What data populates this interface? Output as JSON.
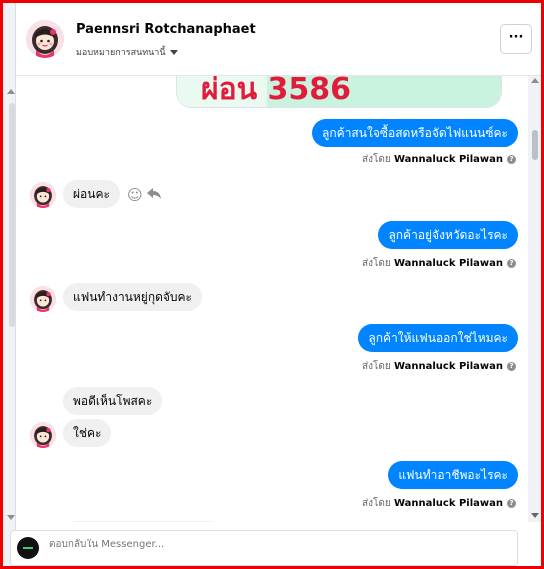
{
  "header": {
    "name": "Paennsri Rotchanaphaet",
    "assign_label": "มอบหมายการสนทนานี้",
    "more_label": "···"
  },
  "banner": {
    "text": "ผ่อน 3586"
  },
  "messages": {
    "m1": {
      "text": "ลูกค้าสนใจซื้อสดหรือจัดไฟแนนซ์คะ"
    },
    "m2": {
      "text": "ผ่อนคะ"
    },
    "m3": {
      "text": "ลูกค้าอยู่จังหวัดอะไรคะ"
    },
    "m4": {
      "text": "แฟนทำงานหยู่กุดจับคะ"
    },
    "m5": {
      "text": "ลูกค้าให้แฟนออกใช่ไหมคะ"
    },
    "m6": {
      "text": "พอดีเห็นโพสคะ"
    },
    "m7": {
      "text": "ใช่คะ"
    },
    "m8": {
      "text": "แฟนทำอาชีพอะไรคะ"
    }
  },
  "sent_by": {
    "prefix": "ส่งโดย",
    "agent": "Wannaluck Pilawan"
  },
  "composer": {
    "placeholder": "ตอบกลับใน Messenger..."
  },
  "colors": {
    "outgoing": "#0084ff",
    "incoming": "#f0f0f0",
    "frame": "#ee0000"
  },
  "icons": [
    "more-options-icon",
    "chevron-down-icon",
    "info-icon",
    "emoji-icon",
    "reply-icon"
  ]
}
